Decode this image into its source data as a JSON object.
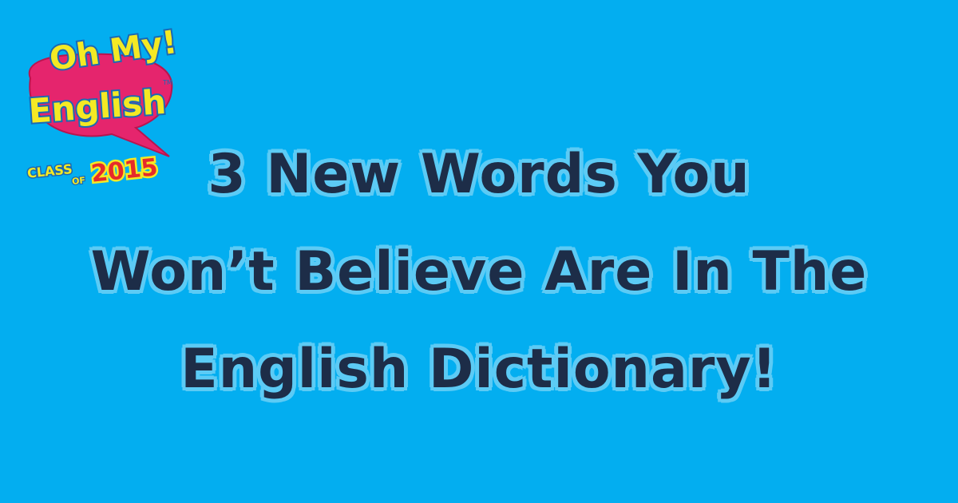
{
  "logo": {
    "line1": "Oh My!",
    "line2": "English",
    "trademark": "TM",
    "class_label": "CLASS",
    "of_label": "OF",
    "year": "2015",
    "colors": {
      "bubble": "#e5256d",
      "text_fill": "#f4e924",
      "text_outline": "#1a69b4",
      "year_fill": "#e52b2b"
    }
  },
  "headline": {
    "lines": [
      "3 New Words You",
      "Won’t Believe Are In The",
      "English Dictionary!"
    ]
  },
  "colors": {
    "background": "#03aef0",
    "headline_text": "#1d2d48",
    "headline_outline": "#5ccbf5"
  }
}
